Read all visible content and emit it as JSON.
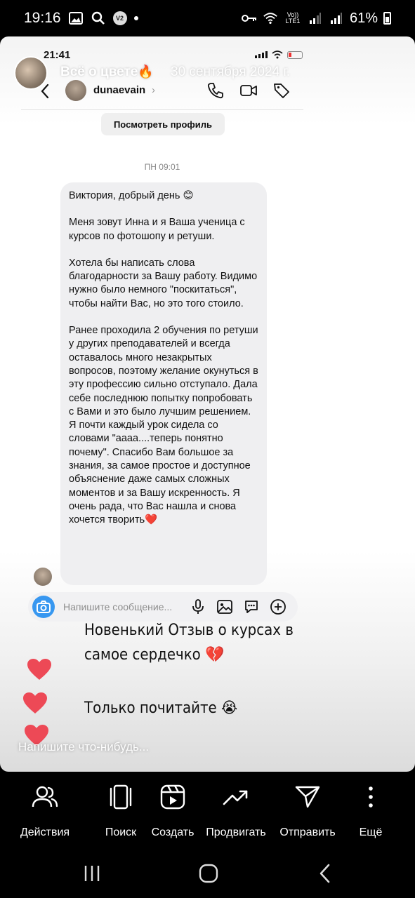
{
  "status_bar": {
    "time": "19:16",
    "network": "Vo)) LTE1",
    "battery": "61%"
  },
  "story": {
    "username": "Всё о цвете",
    "emoji": "🔥",
    "date": "30 сентября 2024 г.",
    "reply_placeholder": "Напишите что-нибудь..."
  },
  "screenshot": {
    "time": "21:41",
    "dm_username": "dunaevain",
    "view_profile": "Посмотреть профиль",
    "message_time": "ПН 09:01",
    "message_paragraphs": [
      "Виктория, добрый день 😊",
      "Меня зовут Инна и я Ваша ученица с курсов по фотошопу и ретуши.",
      "Хотела бы написать слова благодарности за Вашу работу. Видимо нужно было немного \"поскитаться\", чтобы найти Вас, но это того стоило.",
      "Ранее проходила 2 обучения по ретуши у других преподавателей и всегда оставалось много незакрытых вопросов, поэтому желание окунуться в эту профессию сильно отступало. Дала себе последнюю попытку попробовать с Вами и это было лучшим решением. Я почти каждый урок сидела со словами \"аааа....теперь понятно почему\". Спасибо Вам большое за знания, за самое простое и доступное объяснение даже самых сложных моментов и за Вашу искренность. Я очень рада, что Вас нашла и снова хочется творить❤️"
    ],
    "composer_placeholder": "Напишите сообщение..."
  },
  "captions": {
    "line1": "Новенький Отзыв о курсах в самое сердечко 💔",
    "line2": "Только почитайте 😭"
  },
  "actions": [
    {
      "label": "Действия",
      "icon": "people-icon"
    },
    {
      "label": "Поиск",
      "icon": "carousel-icon"
    },
    {
      "label": "Создать",
      "icon": "reels-icon"
    },
    {
      "label": "Продвигать",
      "icon": "trend-icon"
    },
    {
      "label": "Отправить",
      "icon": "send-icon"
    },
    {
      "label": "Ещё",
      "icon": "more-vertical-icon"
    }
  ],
  "colors": {
    "accent_blue": "#3797f0",
    "heart_red": "#ed4956"
  }
}
